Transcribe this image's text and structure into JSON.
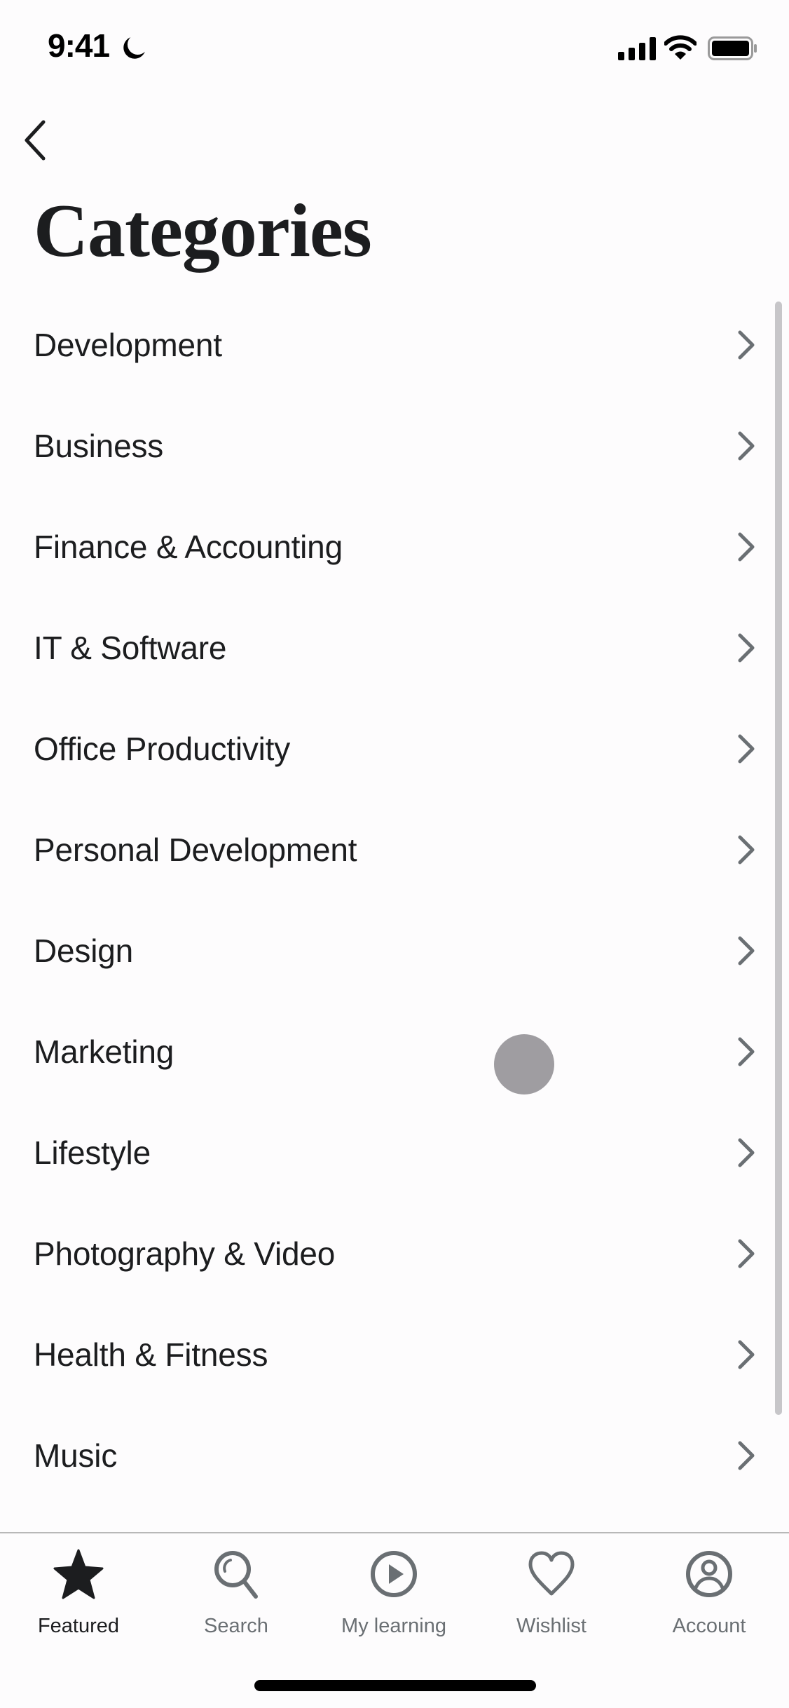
{
  "status_bar": {
    "time": "9:41",
    "icons": [
      "moon-icon",
      "cellular-signal-icon",
      "wifi-icon",
      "battery-icon"
    ]
  },
  "header": {
    "back_icon": "chevron-left-icon",
    "title": "Categories"
  },
  "categories": [
    {
      "label": "Development"
    },
    {
      "label": "Business"
    },
    {
      "label": "Finance & Accounting"
    },
    {
      "label": "IT & Software"
    },
    {
      "label": "Office Productivity"
    },
    {
      "label": "Personal Development"
    },
    {
      "label": "Design"
    },
    {
      "label": "Marketing"
    },
    {
      "label": "Lifestyle"
    },
    {
      "label": "Photography & Video"
    },
    {
      "label": "Health & Fitness"
    },
    {
      "label": "Music"
    }
  ],
  "tab_bar": {
    "tabs": [
      {
        "label": "Featured",
        "icon": "star-icon",
        "active": true
      },
      {
        "label": "Search",
        "icon": "search-icon",
        "active": false
      },
      {
        "label": "My learning",
        "icon": "play-circle-icon",
        "active": false
      },
      {
        "label": "Wishlist",
        "icon": "heart-icon",
        "active": false
      },
      {
        "label": "Account",
        "icon": "account-icon",
        "active": false
      }
    ]
  },
  "colors": {
    "text_primary": "#1c1d1f",
    "text_secondary": "#6a6f73",
    "chevron": "#6a6f73",
    "background": "#fdfcfd"
  }
}
